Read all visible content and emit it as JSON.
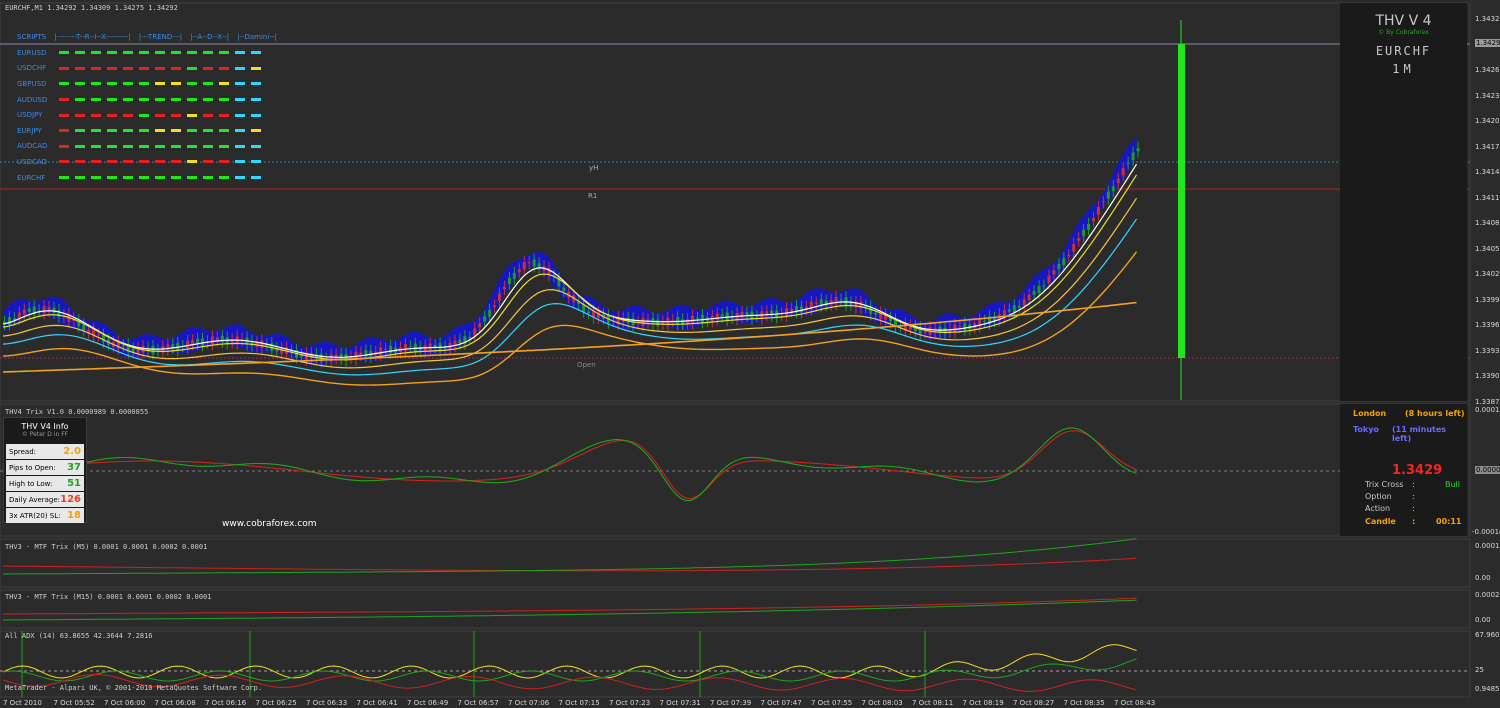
{
  "symbol_line": "EURCHF,M1  1.34292 1.34309 1.34275 1.34292",
  "scripts_header": [
    "SCRIPTS",
    "|--------T--R--I--X---------|",
    "|---TREND---|",
    "|--A--D--X--|",
    "|--Damini--|"
  ],
  "pairs": [
    {
      "name": "EURUSD",
      "dashes": [
        "green",
        "green",
        "green",
        "green",
        "green",
        "green",
        "green",
        "green",
        "green",
        "green",
        "green",
        "cyan",
        "cyan"
      ]
    },
    {
      "name": "USDCHF",
      "dashes": [
        "red",
        "red",
        "red",
        "red",
        "red",
        "red",
        "red",
        "red",
        "green",
        "red",
        "red",
        "cyan",
        "yellow"
      ]
    },
    {
      "name": "GBPUSD",
      "dashes": [
        "green",
        "green",
        "green",
        "green",
        "green",
        "green",
        "yellow",
        "yellow",
        "green",
        "green",
        "yellow",
        "cyan",
        "cyan"
      ]
    },
    {
      "name": "AUDUSD",
      "dashes": [
        "red",
        "green",
        "green",
        "green",
        "green",
        "green",
        "green",
        "green",
        "green",
        "green",
        "green",
        "cyan",
        "cyan"
      ]
    },
    {
      "name": "USDJPY",
      "dashes": [
        "red",
        "red",
        "red",
        "red",
        "red",
        "green",
        "red",
        "red",
        "yellow",
        "red",
        "red",
        "cyan",
        "cyan"
      ]
    },
    {
      "name": "EURJPY",
      "dashes": [
        "red",
        "green",
        "green",
        "green",
        "green",
        "green",
        "yellow",
        "yellow",
        "green",
        "green",
        "green",
        "cyan",
        "yellow"
      ]
    },
    {
      "name": "AUDCAD",
      "dashes": [
        "red",
        "green",
        "green",
        "green",
        "green",
        "green",
        "green",
        "green",
        "green",
        "green",
        "green",
        "cyan",
        "cyan"
      ]
    },
    {
      "name": "USDCAD",
      "dashes": [
        "red",
        "red",
        "red",
        "red",
        "red",
        "red",
        "red",
        "red",
        "yellow",
        "red",
        "red",
        "cyan",
        "cyan"
      ]
    },
    {
      "name": "EURCHF",
      "dashes": [
        "green",
        "green",
        "green",
        "green",
        "green",
        "green",
        "green",
        "green",
        "green",
        "green",
        "green",
        "cyan",
        "cyan"
      ]
    }
  ],
  "dash_colors": {
    "green": "#22e622",
    "red": "#e52020",
    "yellow": "#f0e020",
    "cyan": "#30d8ff"
  },
  "chart_labels": {
    "yh": "yH",
    "r1": "R1",
    "open": "Open"
  },
  "price_axis": [
    "1.34325",
    "1.34292",
    "1.34265",
    "1.34235",
    "1.34205",
    "1.34175",
    "1.34145",
    "1.34115",
    "1.34085",
    "1.34055",
    "1.34025",
    "1.33995",
    "1.33965",
    "1.33935",
    "1.33905",
    "1.33875"
  ],
  "thv_box": {
    "title": "THV V 4",
    "subtitle": "© By Cobraforex",
    "pair": "EURCHF",
    "timeframe": "1M"
  },
  "trix_panel": {
    "title": "THV4 Trix V1.0 0.0000989 0.0000855",
    "axis": [
      "0.00017",
      "0.0000",
      "-0.00016"
    ],
    "website": "www.cobraforex.com"
  },
  "info_box": {
    "title": "THV  V4  Info",
    "subtitle": "© Peter D in FF",
    "rows": [
      {
        "label": "Spread:",
        "value": "2.0",
        "color": "#f5a300"
      },
      {
        "label": "Pips to Open:",
        "value": "37",
        "color": "#1ea51e"
      },
      {
        "label": "High to Low:",
        "value": "51",
        "color": "#1ea51e"
      },
      {
        "label": "Daily Average:",
        "value": "126",
        "color": "#f04020"
      },
      {
        "label": "3x ATR(20) SL:",
        "value": "18",
        "color": "#f5a300"
      }
    ]
  },
  "session_box": {
    "london_label": "London",
    "london_value": "(8 hours left)",
    "tokyo_label": "Tokyo",
    "tokyo_value": "(11 minutes left)",
    "price": "1.3429",
    "trix_cross_label": "Trix Cross",
    "trix_cross_value": "Bull",
    "option_label": "Option",
    "action_label": "Action",
    "candle_label": "Candle",
    "candle_value": "00:11",
    "sep": ":"
  },
  "mtf_m5": {
    "title": "THV3 - MTF Trix (M5) 0.0001 0.0001 0.0002 0.0001",
    "axis": [
      "0.0001",
      "0.00"
    ]
  },
  "mtf_m15": {
    "title": "THV3 - MTF Trix (M15) 0.0001 0.0001 0.0002 0.0001",
    "axis": [
      "0.0002",
      "0.00"
    ]
  },
  "adx_panel": {
    "title": "All ADX (14) 63.8655 42.3644 7.2816",
    "axis": [
      "67.9608",
      "25",
      "0.9485"
    ],
    "copyright": "MetaTrader - Alpari UK, © 2001-2010 MetaQuotes Software Corp."
  },
  "time_axis": [
    "7 Oct 2010",
    "7 Oct 05:52",
    "7 Oct 06:00",
    "7 Oct 06:08",
    "7 Oct 06:16",
    "7 Oct 06:25",
    "7 Oct 06:33",
    "7 Oct 06:41",
    "7 Oct 06:49",
    "7 Oct 06:57",
    "7 Oct 07:06",
    "7 Oct 07:15",
    "7 Oct 07:23",
    "7 Oct 07:31",
    "7 Oct 07:39",
    "7 Oct 07:47",
    "7 Oct 07:55",
    "7 Oct 08:03",
    "7 Oct 08:11",
    "7 Oct 08:19",
    "7 Oct 08:27",
    "7 Oct 08:35",
    "7 Oct 08:43"
  ],
  "colors": {
    "bg": "#2b2b2b",
    "bull": "#1e9e1e",
    "bear": "#c83232",
    "cloud": "#1818d8",
    "bar": "#22e622"
  }
}
